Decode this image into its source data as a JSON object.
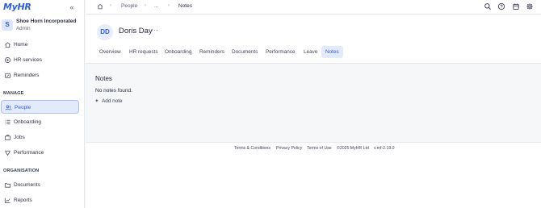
{
  "app": {
    "logo": "MyHR",
    "collapse_glyph": "«"
  },
  "company": {
    "initial": "S",
    "name": "Shoe Horn Incorporated",
    "role": "Admin"
  },
  "sidebar": {
    "items": [
      {
        "label": "Home",
        "icon": "home-icon"
      },
      {
        "label": "HR services",
        "icon": "hr-services-icon"
      },
      {
        "label": "Reminders",
        "icon": "reminders-icon"
      }
    ],
    "manage_heading": "MANAGE",
    "manage_items": [
      {
        "label": "People",
        "icon": "people-icon",
        "active": true
      },
      {
        "label": "Onboarding",
        "icon": "onboarding-icon"
      },
      {
        "label": "Jobs",
        "icon": "jobs-icon"
      },
      {
        "label": "Performance",
        "icon": "performance-icon"
      }
    ],
    "organisation_heading": "ORGANISATION",
    "organisation_items": [
      {
        "label": "Documents",
        "icon": "documents-icon"
      },
      {
        "label": "Reports",
        "icon": "reports-icon"
      }
    ]
  },
  "breadcrumb": {
    "items": [
      "People",
      "...",
      "Notes"
    ],
    "separator": "›"
  },
  "topbar_icons": [
    "search-icon",
    "help-icon",
    "calendar-icon",
    "settings-icon"
  ],
  "profile": {
    "initials": "DD",
    "name": "Doris Day",
    "more": "···"
  },
  "tabs": [
    "Overview",
    "HR requests",
    "Onboarding",
    "Reminders",
    "Documents",
    "Performance",
    "Leave",
    "Notes"
  ],
  "active_tab": "Notes",
  "notes": {
    "title": "Notes",
    "empty_text": "No notes found.",
    "add_label": "Add note",
    "add_glyph": "+"
  },
  "footer": {
    "links": [
      "Terms & Conditions",
      "Privacy Policy",
      "Terms of Use",
      "©2025 MyHR Ltd",
      "v.mf-2.19.0"
    ]
  },
  "colors": {
    "accent": "#2f5fd0",
    "active_bg": "#e3eafc",
    "page_bg": "#f6f7f9",
    "text": "#1f2433"
  }
}
